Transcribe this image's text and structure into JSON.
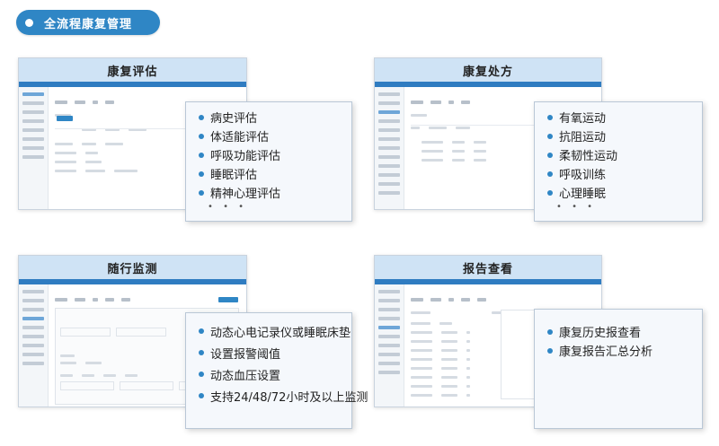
{
  "header": {
    "title": "全流程康复管理"
  },
  "sections": [
    {
      "title": "康复评估",
      "items": [
        "病史评估",
        "体适能评估",
        "呼吸功能评估",
        "睡眠评估",
        "精神心理评估"
      ],
      "more": "• • •"
    },
    {
      "title": "康复处方",
      "items": [
        "有氧运动",
        "抗阻运动",
        "柔韧性运动",
        "呼吸训练",
        "心理睡眠"
      ],
      "more": "• • •"
    },
    {
      "title": "随行监测",
      "items": [
        "动态心电记录仪或睡眠床垫",
        "设置报警阈值",
        "动态血压设置",
        "支持24/48/72小时及以上监测"
      ]
    },
    {
      "title": "报告查看",
      "items": [
        "康复历史报查看",
        "康复报告汇总分析"
      ]
    }
  ],
  "colors": {
    "accent": "#2f86c5",
    "panel_header": "#cfe3f5",
    "callout_bg": "#f5f8fc"
  }
}
